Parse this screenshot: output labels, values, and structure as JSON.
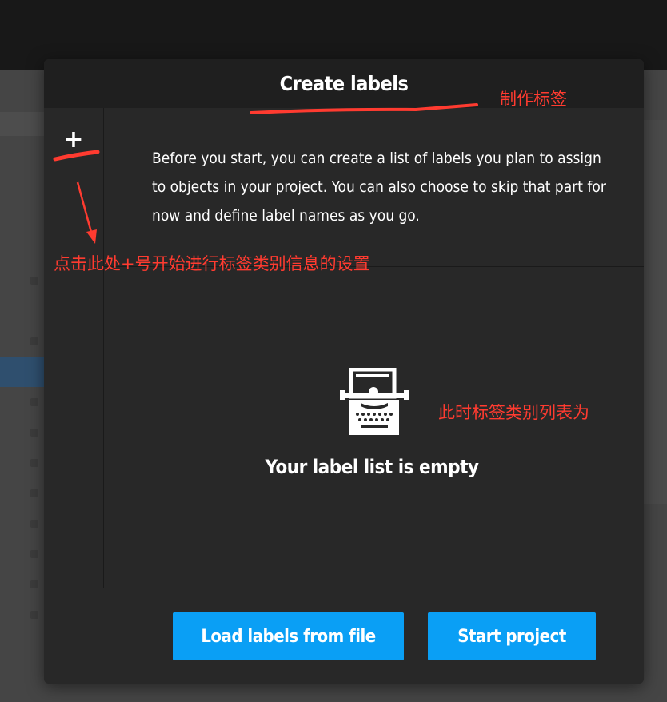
{
  "modal": {
    "title": "Create labels",
    "add_label_glyph": "+",
    "description": "Before you start, you can create a list of labels you plan to assign to objects in your project. You can also choose to skip that part for now and define label names as you go.",
    "empty_state": {
      "icon": "typewriter-icon",
      "text": "Your label list is empty"
    },
    "buttons": {
      "load_labels": "Load labels from file",
      "start_project": "Start project"
    }
  },
  "annotations": {
    "title_note": "制作标签",
    "plus_note": "点击此处+号开始进行标签类别信息的设置",
    "list_note": "此时标签类别列表为"
  },
  "colors": {
    "accent": "#0a9ff5",
    "annotation": "#ff3b30",
    "modal_bg": "#282828",
    "header_bg": "#1f1f1f"
  }
}
